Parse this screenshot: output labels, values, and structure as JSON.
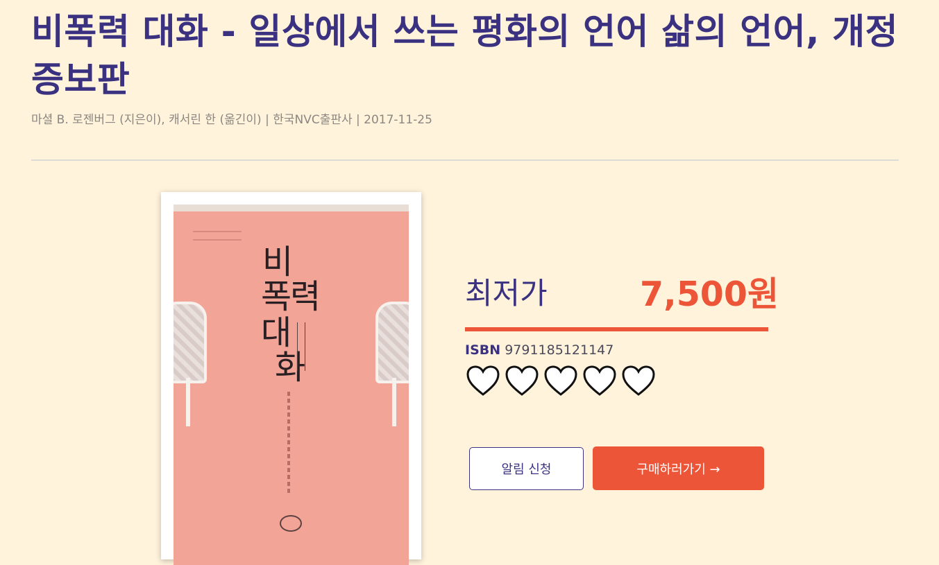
{
  "book": {
    "title": "비폭력 대화 - 일상에서 쓰는 평화의 언어 삶의 언어, 개정증보판",
    "meta": "마셜 B. 로젠버그 (지은이), 캐서린 한 (옮긴이) | 한국NVC출판사 | 2017-11-25",
    "cover_title_chars": [
      "비",
      "폭",
      "력",
      "대",
      "화"
    ]
  },
  "price": {
    "label": "최저가",
    "value": "7,500원"
  },
  "isbn": {
    "label": "ISBN",
    "value": "9791185121147"
  },
  "rating": {
    "icon": "heart-icon",
    "filled": 0,
    "total": 5
  },
  "actions": {
    "alert_label": "알림 신청",
    "buy_label": "구매하러가기 →"
  },
  "colors": {
    "background": "#fff3dc",
    "title": "#3a3181",
    "accent": "#ec5538",
    "cover": "#f2a497"
  }
}
